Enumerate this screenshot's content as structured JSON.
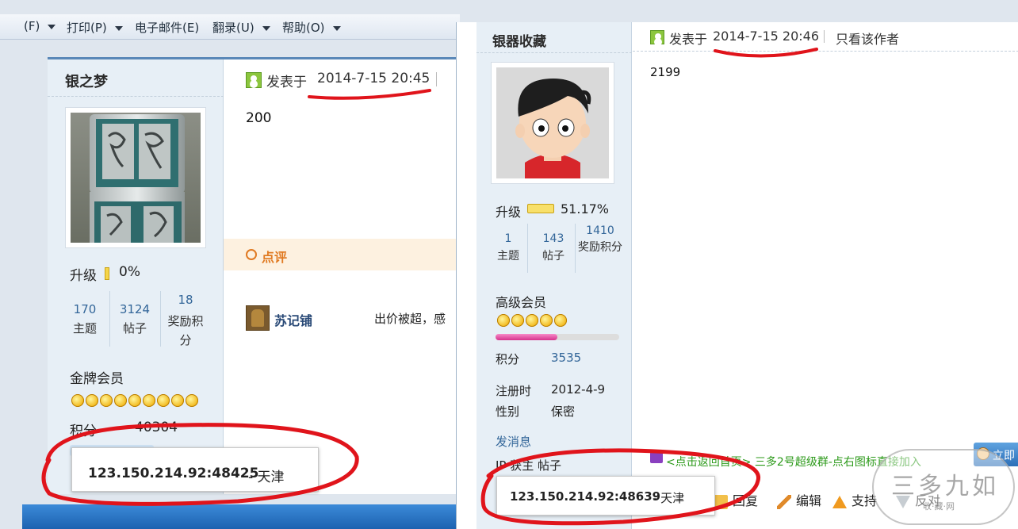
{
  "menubar": {
    "items": [
      "(F)",
      "打印(P)",
      "电子邮件(E)",
      "翻录(U)",
      "帮助(O)"
    ]
  },
  "left_post": {
    "author": "银之梦",
    "posted_prefix": "发表于",
    "posted_time": "2014-7-15 20:45",
    "content": "200",
    "level_label": "升级",
    "level_percent": "0%",
    "level_progress": 0.0,
    "stats": [
      {
        "num": "170",
        "label": "主题"
      },
      {
        "num": "3124",
        "label": "帖子"
      },
      {
        "num": "18",
        "label": "奖励积分"
      }
    ],
    "rank": "金牌会员",
    "stars": 9,
    "points_label": "积分",
    "points_value": "40304",
    "review_label": "点评",
    "commenter": "苏记铺",
    "comment_text": "出价被超，感",
    "ip_text": "123.150.214.92:48425",
    "ip_location": "- 天津"
  },
  "right_post": {
    "author": "银器收藏",
    "posted_prefix": "发表于",
    "posted_time": "2014-7-15 20:46",
    "only_author": "只看该作者",
    "content": "2199",
    "level_label": "升级",
    "level_percent": "51.17%",
    "level_progress": 0.5117,
    "stats": [
      {
        "num": "1",
        "label": "主题"
      },
      {
        "num": "143",
        "label": "帖子"
      },
      {
        "num": "1410",
        "label": "奖励积分"
      }
    ],
    "rank": "高级会员",
    "stars": 5,
    "rank_progress": 0.5,
    "points_label": "积分",
    "points_value": "3535",
    "reg_label": "注册时",
    "reg_value": "2012-4-9",
    "gender_label": "性别",
    "gender_value": "保密",
    "message_link": "发消息",
    "ip_row": "IP 获主 帖子",
    "qq_banner": "<点击返回首页> 三多2号超级群-点右图标直接加入",
    "join_btn": "立即",
    "ip_text": "123.150.214.92:48639",
    "ip_location": "- 天津",
    "actions": [
      "回复",
      "编辑",
      "支持",
      "反对"
    ]
  },
  "watermark": {
    "text": "三多九如",
    "sub": "收·藏·网"
  },
  "colors": {
    "annotation": "#e0141b",
    "link_blue": "#336699",
    "sidebar_bg": "#e7eff6"
  }
}
